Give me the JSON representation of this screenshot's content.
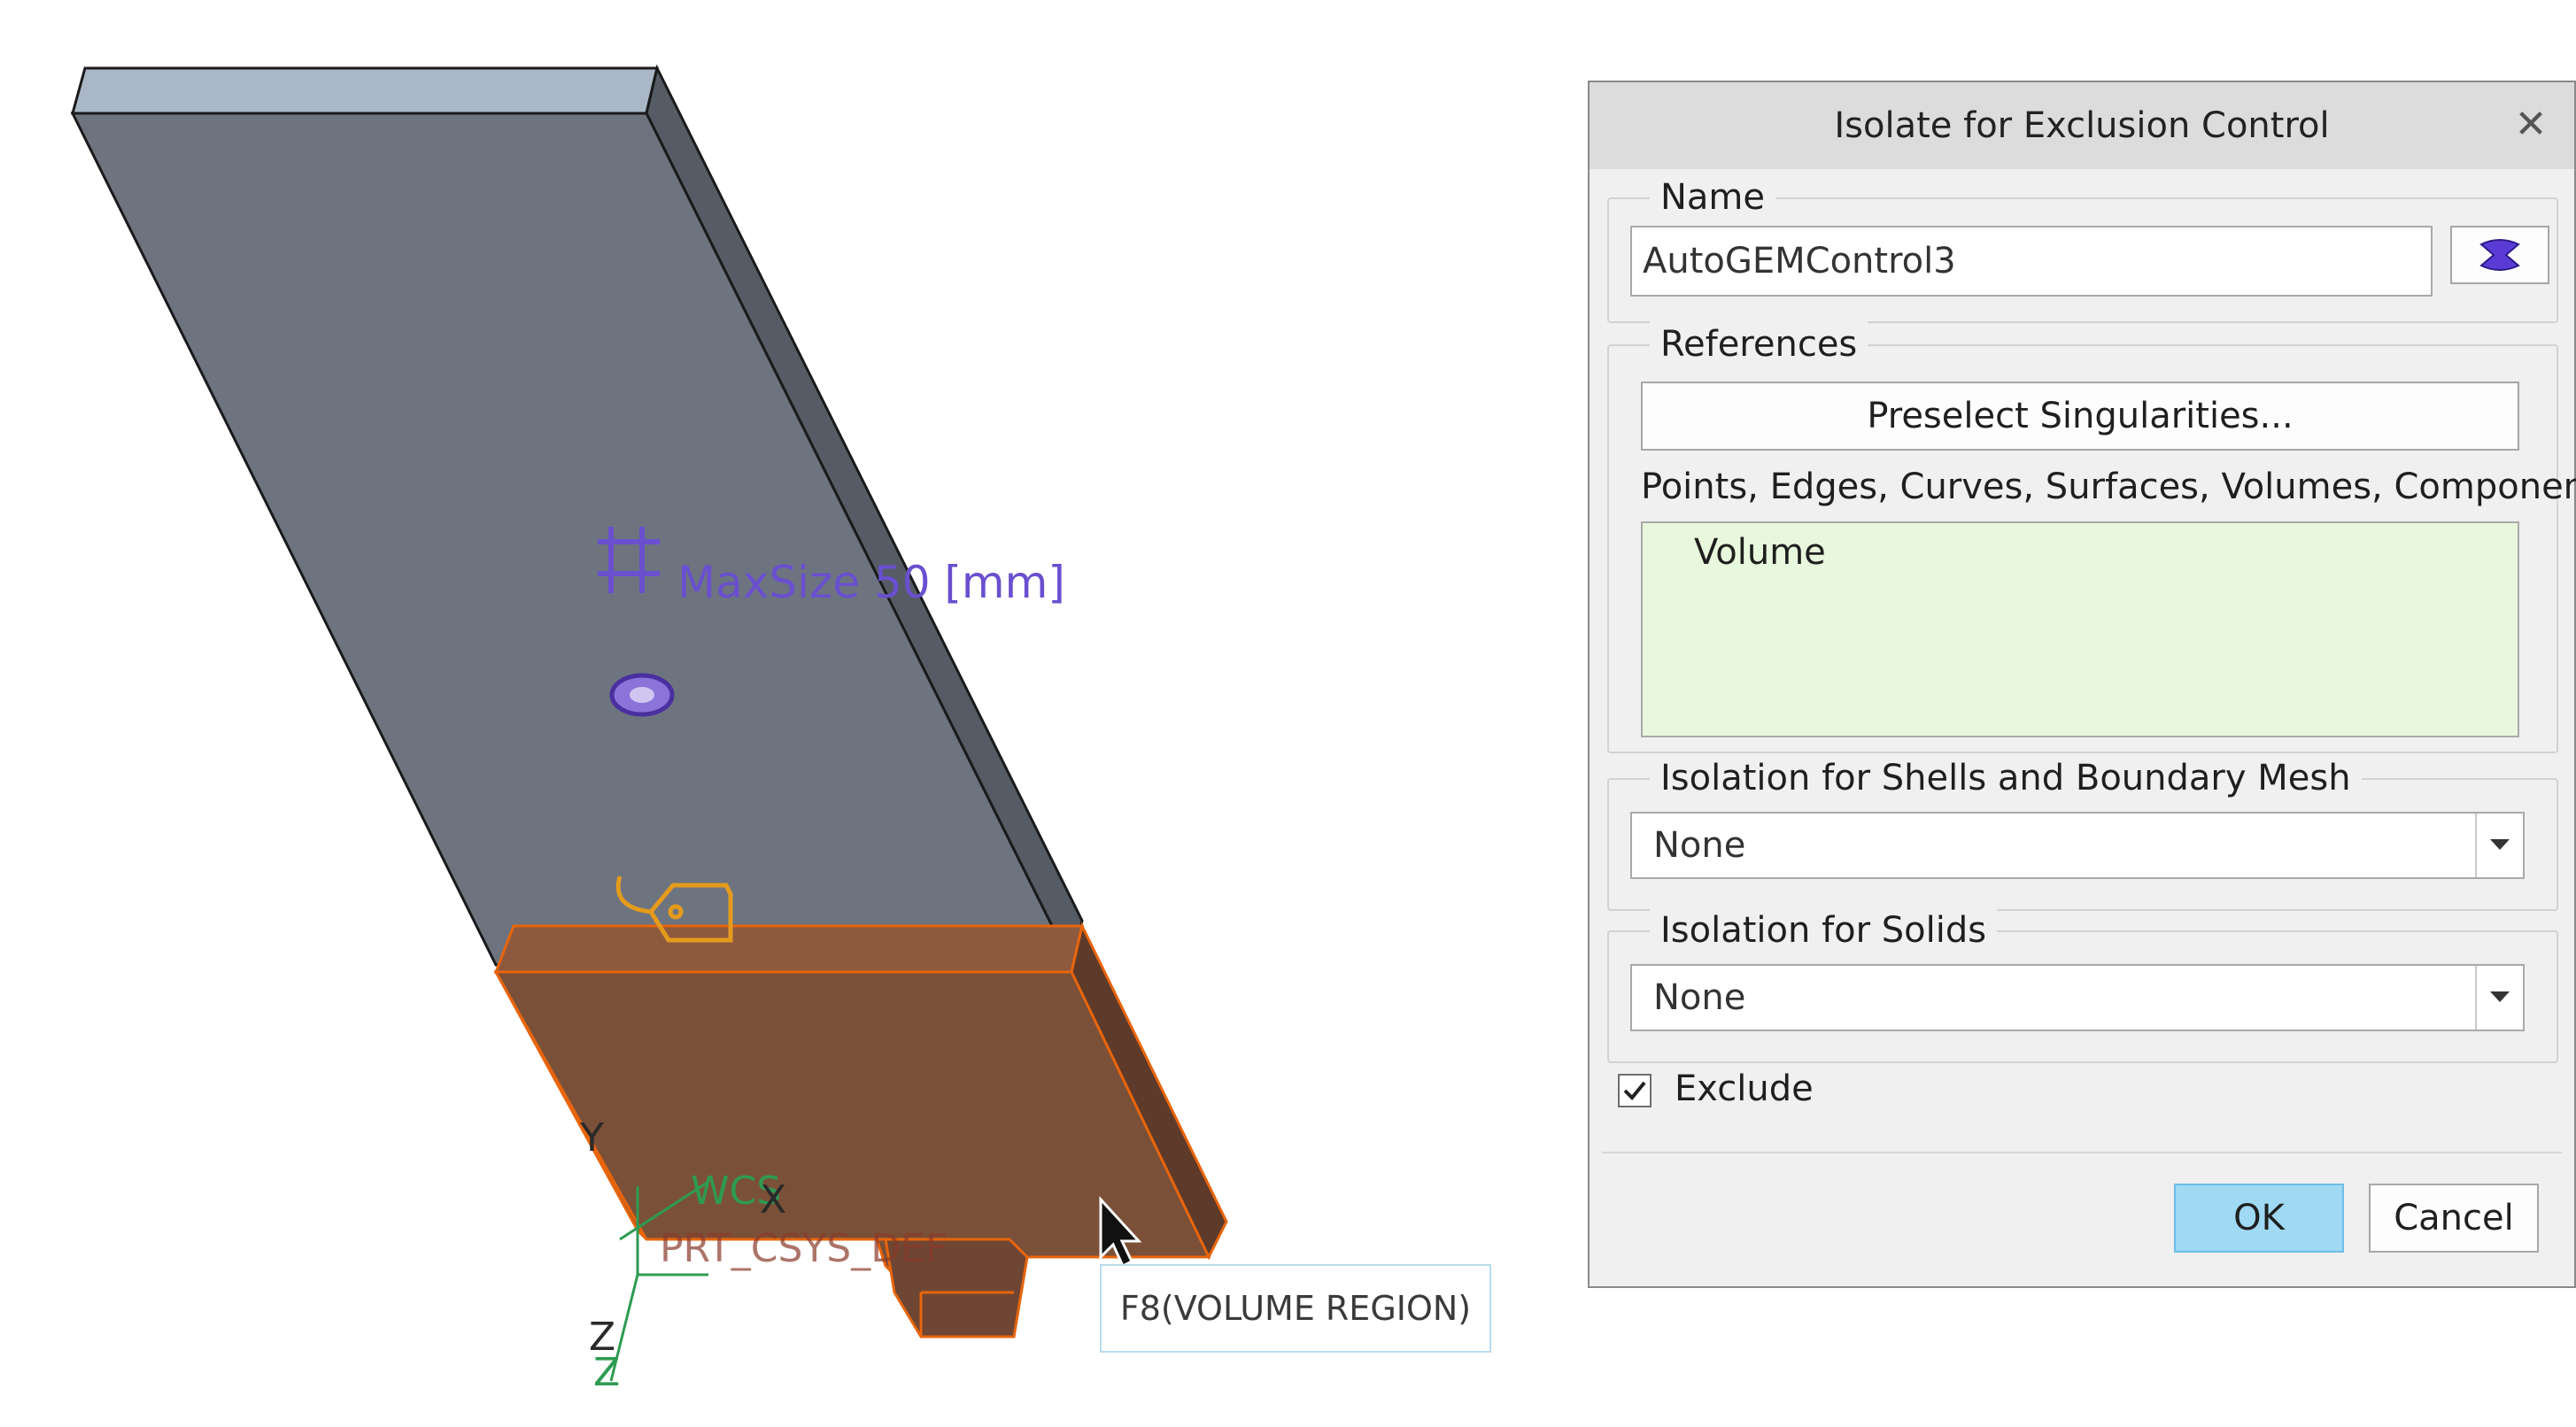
{
  "viewport": {
    "annotation_maxsize": "MaxSize 50 [mm]",
    "csys_label_wcs": "WCS",
    "csys_label_prt": "PRT_CSYS_DEF",
    "axis_y": "Y",
    "axis_x": "X",
    "axis_z": "Z",
    "tooltip": "F8(VOLUME REGION)",
    "colors": {
      "body": "#6d7480",
      "body_side": "#5a606b",
      "body_top": "#a9b7c6",
      "highlight": "#7a5038",
      "highlight_edge": "#e8650c",
      "annotation": "#6a4fcf",
      "tag": "#e49b1c"
    }
  },
  "dialog": {
    "title": "Isolate for Exclusion Control",
    "close_icon": "close-icon",
    "name_group": {
      "label": "Name",
      "value": "AutoGEMControl3",
      "color_button_icon": "color-swatch-icon"
    },
    "references_group": {
      "label": "References",
      "preselect_button": "Preselect Singularities...",
      "filter_caption": "Points, Edges, Curves, Surfaces, Volumes, Components",
      "items": [
        "Volume"
      ]
    },
    "shells_group": {
      "label": "Isolation for Shells and Boundary Mesh",
      "selected": "None"
    },
    "solids_group": {
      "label": "Isolation for Solids",
      "selected": "None"
    },
    "exclude": {
      "label": "Exclude",
      "checked": true
    },
    "ok_button": "OK",
    "cancel_button": "Cancel"
  }
}
